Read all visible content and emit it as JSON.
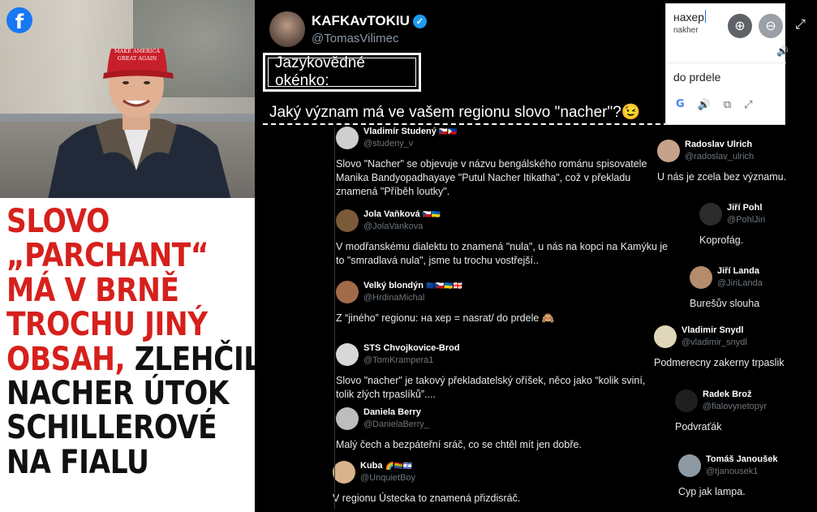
{
  "left_panel": {
    "facebook_icon": "f",
    "headline_lines": [
      {
        "red": "SLOVO",
        "black": ""
      },
      {
        "red": "„PARCHANT“",
        "black": ""
      },
      {
        "red": "MÁ V BRNĚ",
        "black": ""
      },
      {
        "red": "TROCHU JINÝ",
        "black": ""
      },
      {
        "red": "OBSAH,",
        "black": " ZLEHČIL"
      },
      {
        "red": "",
        "black": "NACHER ÚTOK"
      },
      {
        "red": "",
        "black": "SCHILLEROVÉ"
      },
      {
        "red": "",
        "black": "NA FIALU"
      }
    ]
  },
  "post": {
    "author_name": "KAFKAvTOKIU",
    "author_handle": "@TomasVilimec",
    "verified_mark": "✓",
    "boxed_title": "Jazykovědné okénko:",
    "question": "Jaký význam má ve vašem regionu slovo \"nacher\"?😉"
  },
  "translate": {
    "source_text": "нахер",
    "transliteration": "nakher",
    "translation": "do prdele",
    "google_icon": "G",
    "speaker_icon": "🔊",
    "copy_icon": "⧉",
    "expand_icon": "⤢",
    "zoom_in_icon": "⊕",
    "zoom_out_icon": "⊖",
    "fullscreen_icon": "⤢"
  },
  "comments_left": [
    {
      "name": "Vladimír Studený",
      "flags": "🇨🇿🇵🇭",
      "handle": "@studeny_v",
      "text": "Slovo \"Nacher\" se objevuje v názvu bengálského románu spisovatele Manika Bandyopadhayaye \"Putul Nacher Itikatha\", což v překladu znamená \"Příběh loutky\"."
    },
    {
      "name": "Jola Vaňková",
      "flags": "🇨🇿🇺🇦",
      "handle": "@JolaVankova",
      "text": "V modřanskému dialektu to znamená \"nula\", u nás na kopci na Kamýku je to \"smradlavá nula\", jsme tu trochu vostřejší.."
    },
    {
      "name": "Velký blondýn",
      "flags": "🇪🇺🇨🇿🇺🇦🇬🇪",
      "handle": "@HrdinaMichal",
      "text": "Z “jiného” regionu: на хер = nasrat/ do prdele 🙈"
    },
    {
      "name": "STS Chvojkovice-Brod",
      "flags": "",
      "handle": "@TomKrampera1",
      "text": "Slovo \"nacher\" je takový překladatelský oříšek, něco jako “kolik sviní, tolik zlých trpaslíků”...."
    },
    {
      "name": "Daniela Berry",
      "flags": "",
      "handle": "@DanielaBerry_",
      "text": "Malý čech a bezpáteřní sráč, co se chtěl mít jen dobře."
    },
    {
      "name": "Kuba",
      "flags": "🌈🏳️‍🌈🇮🇱",
      "handle": "@UnquietBoy",
      "text": "V regionu Ústecka to znamená přizdisráč."
    }
  ],
  "comments_right": [
    {
      "name": "Radoslav Ulrich",
      "handle": "@radoslav_ulrich",
      "text": "U nás je zcela bez významu."
    },
    {
      "name": "Jiří Pohl",
      "handle": "@PohlJiri",
      "text": "Koprofág."
    },
    {
      "name": "Jiří Landa",
      "handle": "@JiriLanda",
      "text": "Burešův slouha"
    },
    {
      "name": "Vladimir Snydl",
      "handle": "@vladimir_snydl",
      "text": "Podmerecny zakerny trpaslik"
    },
    {
      "name": "Radek Brož",
      "handle": "@fialovynetopyr",
      "text": "Podvraťák"
    },
    {
      "name": "Tomáš Janoušek",
      "handle": "@tjanousek1",
      "text": "Cyp jak lampa."
    }
  ]
}
